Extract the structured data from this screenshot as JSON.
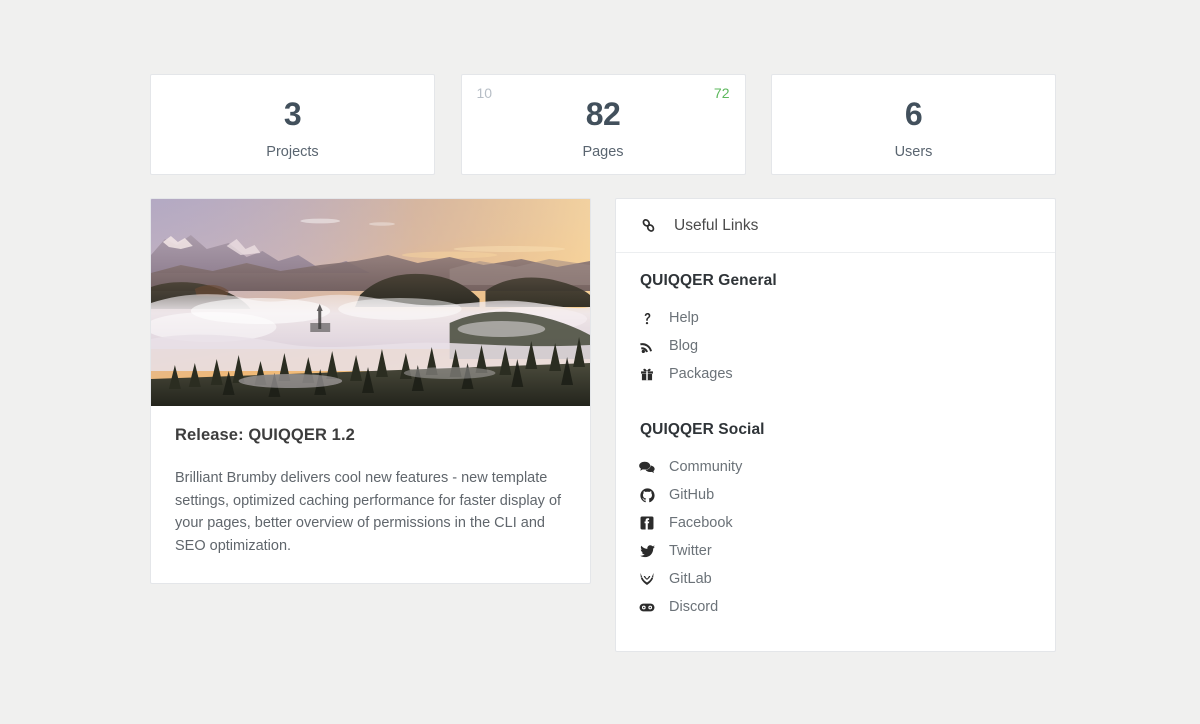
{
  "stats": [
    {
      "name": "projects",
      "value": "3",
      "label": "Projects",
      "corner_left": "",
      "corner_right": ""
    },
    {
      "name": "pages",
      "value": "82",
      "label": "Pages",
      "corner_left": "10",
      "corner_right": "72"
    },
    {
      "name": "users",
      "value": "6",
      "label": "Users",
      "corner_left": "",
      "corner_right": ""
    }
  ],
  "news": {
    "image_alt": "sunrise-mountain-landscape-with-fog",
    "title": "Release: QUIQQER 1.2",
    "text": "Brilliant Brumby delivers cool new features - new template settings, optimized caching performance for faster display of your pages, better overview of permissions in the CLI and SEO optimization."
  },
  "links_panel": {
    "header_icon": "link-chain-icon",
    "header_title": "Useful Links",
    "groups": [
      {
        "title": "QUIQQER General",
        "items": [
          {
            "icon": "question-mark-icon",
            "label": "Help"
          },
          {
            "icon": "rss-feed-icon",
            "label": "Blog"
          },
          {
            "icon": "gift-box-icon",
            "label": "Packages"
          }
        ]
      },
      {
        "title": "QUIQQER Social",
        "items": [
          {
            "icon": "speech-bubble-icon",
            "label": "Community"
          },
          {
            "icon": "github-icon",
            "label": "GitHub"
          },
          {
            "icon": "facebook-icon",
            "label": "Facebook"
          },
          {
            "icon": "twitter-bird-icon",
            "label": "Twitter"
          },
          {
            "icon": "gitlab-fox-icon",
            "label": "GitLab"
          },
          {
            "icon": "discord-controller-icon",
            "label": "Discord"
          }
        ]
      }
    ]
  },
  "colors": {
    "page_background": "#f0f0ef",
    "card_background": "#ffffff",
    "card_border": "#e4e6e9",
    "stat_value": "#42505c",
    "accent_green": "#5cb85c",
    "muted_gray": "#b7bec6",
    "text_body": "#60666c"
  }
}
